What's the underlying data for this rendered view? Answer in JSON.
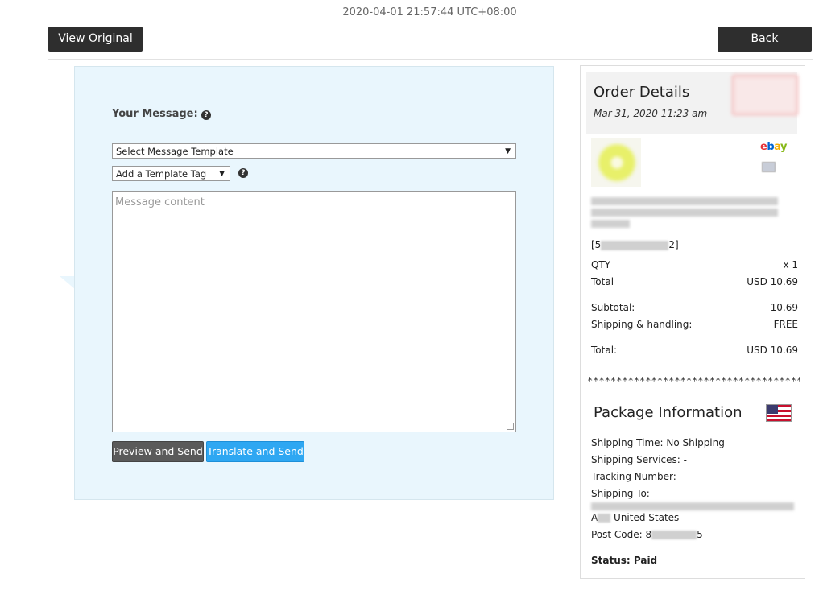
{
  "header": {
    "timestamp": "2020-04-01 21:57:44 UTC+08:00",
    "view_original_label": "View Original",
    "back_label": "Back"
  },
  "compose": {
    "label": "Your Message:",
    "help_glyph": "?",
    "template_select": "Select Message Template",
    "tag_select": "Add a Template Tag",
    "message_placeholder": "Message content",
    "preview_button": "Preview and Send",
    "translate_button": "Translate and Send"
  },
  "order": {
    "title": "Order Details",
    "date": "Mar 31, 2020 11:23 am",
    "platform": "ebay",
    "sku_prefix": "[5",
    "sku_suffix": "2]",
    "qty_label": "QTY",
    "qty_value": "x 1",
    "total_label": "Total",
    "total_value": "USD 10.69",
    "subtotal_label": "Subtotal:",
    "subtotal_value": "10.69",
    "shipping_label": "Shipping & handling:",
    "shipping_value": "FREE",
    "grand_total_label": "Total:",
    "grand_total_value": "USD 10.69",
    "separator": "******************************************"
  },
  "package": {
    "title": "Package Information",
    "shipping_time": "Shipping Time: No Shipping",
    "shipping_services": "Shipping Services: -",
    "tracking_number": "Tracking Number: -",
    "shipping_to_label": "Shipping To:",
    "country_prefix": "A",
    "country": "United States",
    "post_code_label": "Post Code: 8",
    "post_code_suffix": "5",
    "status": "Status: Paid",
    "flag_icon": "us-flag-icon"
  },
  "colors": {
    "compose_bg": "#e9f6fd",
    "dark_button": "#2e2e2e",
    "translate_button": "#2ea7f2",
    "preview_button": "#5a5a5a"
  }
}
